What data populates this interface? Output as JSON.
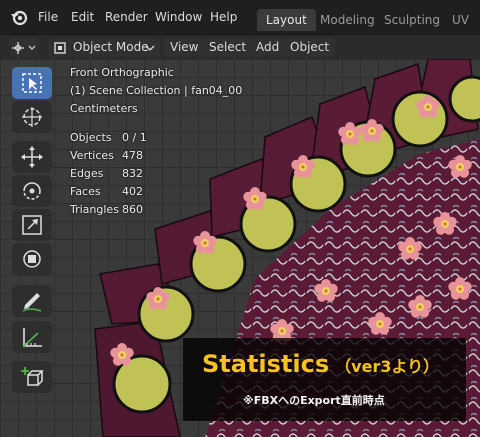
{
  "menu": {
    "file": "File",
    "edit": "Edit",
    "render": "Render",
    "window": "Window",
    "help": "Help"
  },
  "workspaces": [
    "Layout",
    "Modeling",
    "Sculpting",
    "UV E"
  ],
  "header": {
    "mode": "Object Mode",
    "view": "View",
    "select": "Select",
    "add": "Add",
    "object": "Object"
  },
  "overlay": {
    "view_name": "Front Orthographic",
    "collection": "(1) Scene Collection | fan04_00",
    "units": "Centimeters",
    "stats": [
      {
        "label": "Objects",
        "value": "0 / 1"
      },
      {
        "label": "Vertices",
        "value": "478"
      },
      {
        "label": "Edges",
        "value": "832"
      },
      {
        "label": "Faces",
        "value": "402"
      },
      {
        "label": "Triangles",
        "value": "860"
      }
    ]
  },
  "banner": {
    "title": "Statistics",
    "title_suffix": "（ver3より）",
    "subtitle": "※FBXへのExport直前時点"
  },
  "colors": {
    "accent_tool": "#4772b3",
    "banner_title": "#f6c21b",
    "fan_dark": "#5a1a33",
    "medallion": "#c0c256"
  },
  "toolbar_icons": [
    "select-box-icon",
    "cursor-icon",
    "move-icon",
    "rotate-icon",
    "scale-icon",
    "transform-icon",
    "annotate-icon",
    "measure-icon",
    "add-cube-icon"
  ]
}
